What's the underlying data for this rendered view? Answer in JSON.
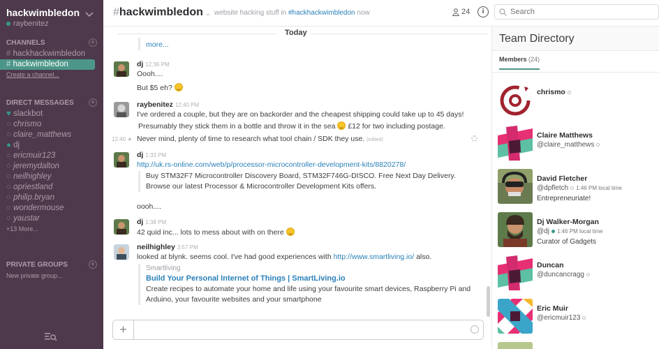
{
  "team": {
    "name": "hackwimbledon",
    "user": "raybenitez"
  },
  "sidebar": {
    "channels_title": "CHANNELS",
    "channels": [
      {
        "label": "hackhackwimbledon",
        "active": false
      },
      {
        "label": "hackwimbledon",
        "active": true
      }
    ],
    "create_channel": "Create a channel...",
    "dm_title": "DIRECT MESSAGES",
    "dms": [
      {
        "label": "slackbot",
        "status": "heart",
        "italic": false
      },
      {
        "label": "chrismo",
        "status": "away",
        "italic": true
      },
      {
        "label": "claire_matthews",
        "status": "away",
        "italic": true
      },
      {
        "label": "dj",
        "status": "online",
        "italic": false
      },
      {
        "label": "ericmuir123",
        "status": "away",
        "italic": true
      },
      {
        "label": "jeremydalton",
        "status": "away",
        "italic": true
      },
      {
        "label": "neilhighley",
        "status": "away",
        "italic": true
      },
      {
        "label": "opriestland",
        "status": "away",
        "italic": true
      },
      {
        "label": "philip.bryan",
        "status": "away",
        "italic": true
      },
      {
        "label": "wondermouse",
        "status": "away",
        "italic": true
      },
      {
        "label": "yaustar",
        "status": "away",
        "italic": true
      }
    ],
    "more": "+13 More...",
    "private_title": "PRIVATE GROUPS",
    "new_private": "New private group..."
  },
  "header": {
    "channel_name": "hackwimbledon",
    "topic_prefix": "website hacking stuff in",
    "topic_link": "#hackhackwimbledon",
    "topic_suffix": "now",
    "member_count": "24",
    "search_placeholder": "Search"
  },
  "messages": {
    "divider": "Today",
    "more_link": "more...",
    "m1": {
      "author": "dj",
      "time": "12:36 PM",
      "line1": "Oooh....",
      "line2": "But $5 eh?"
    },
    "m2": {
      "author": "raybenitez",
      "time": "12:40 PM",
      "line1": "I've ordered a couple, but they are on backorder and the cheapest shipping could take up to 45 days!",
      "line2a": "Presumably they stick them in a bottle and throw it in the sea",
      "line2b": "£12 for two including postage.",
      "side_time": "12:40",
      "line3": "Never mind, plenty of time to research what tool chain / SDK they use.",
      "edited": "(edited)"
    },
    "m3": {
      "author": "dj",
      "time": "1:33 PM",
      "link": "http://uk.rs-online.com/web/p/processor-microcontroller-development-kits/8820278/",
      "attach1": "Buy STM32F7 Microcontroller Discovery Board, STM32F746G-DISCO. Free Next Day Delivery.",
      "attach2": "Browse our latest Processor & Microcontroller Development Kits offers.",
      "line_after": "oooh...."
    },
    "m4": {
      "author": "dj",
      "time": "1:38 PM",
      "line1": "42 quid inc... lots to mess about with on there"
    },
    "m5": {
      "author": "neilhighley",
      "time": "3:57 PM",
      "line1a": "looked at blynk. seems cool. I've had good experiences with",
      "line1_link": "http://www.smartliving.io/",
      "line1b": "also.",
      "svc": "Smartliving",
      "title": "Build Your Personal Internet of Things | SmartLiving.io",
      "desc1": "Create recipes to automate your home and life using your favourite smart devices, Raspberry Pi and",
      "desc2": "Arduino, your favourite websites and your smartphone"
    }
  },
  "panel": {
    "title": "Team Directory",
    "tab_label": "Members",
    "tab_count": "(24)",
    "members": [
      {
        "name": "chrismo",
        "handle": "",
        "local_time": "",
        "title": "",
        "presence": "away"
      },
      {
        "name": "Claire Matthews",
        "handle": "@claire_matthews",
        "local_time": "",
        "title": "",
        "presence": "away"
      },
      {
        "name": "David Fletcher",
        "handle": "@dpfletch",
        "local_time": "1:46 PM local time",
        "title": "Entrepreneuriate!",
        "presence": "away"
      },
      {
        "name": "Dj Walker-Morgan",
        "handle": "@dj",
        "local_time": "1:46 PM local time",
        "title": "Curator of Gadgets",
        "presence": "online"
      },
      {
        "name": "Duncan",
        "handle": "@duncancragg",
        "local_time": "",
        "title": "",
        "presence": "away"
      },
      {
        "name": "Eric Muir",
        "handle": "@ericmuir123",
        "local_time": "",
        "title": "",
        "presence": "away"
      }
    ]
  },
  "colors": {
    "sidebar": "#4d394b",
    "active_channel": "#4c9689",
    "link": "#2a80b9"
  }
}
